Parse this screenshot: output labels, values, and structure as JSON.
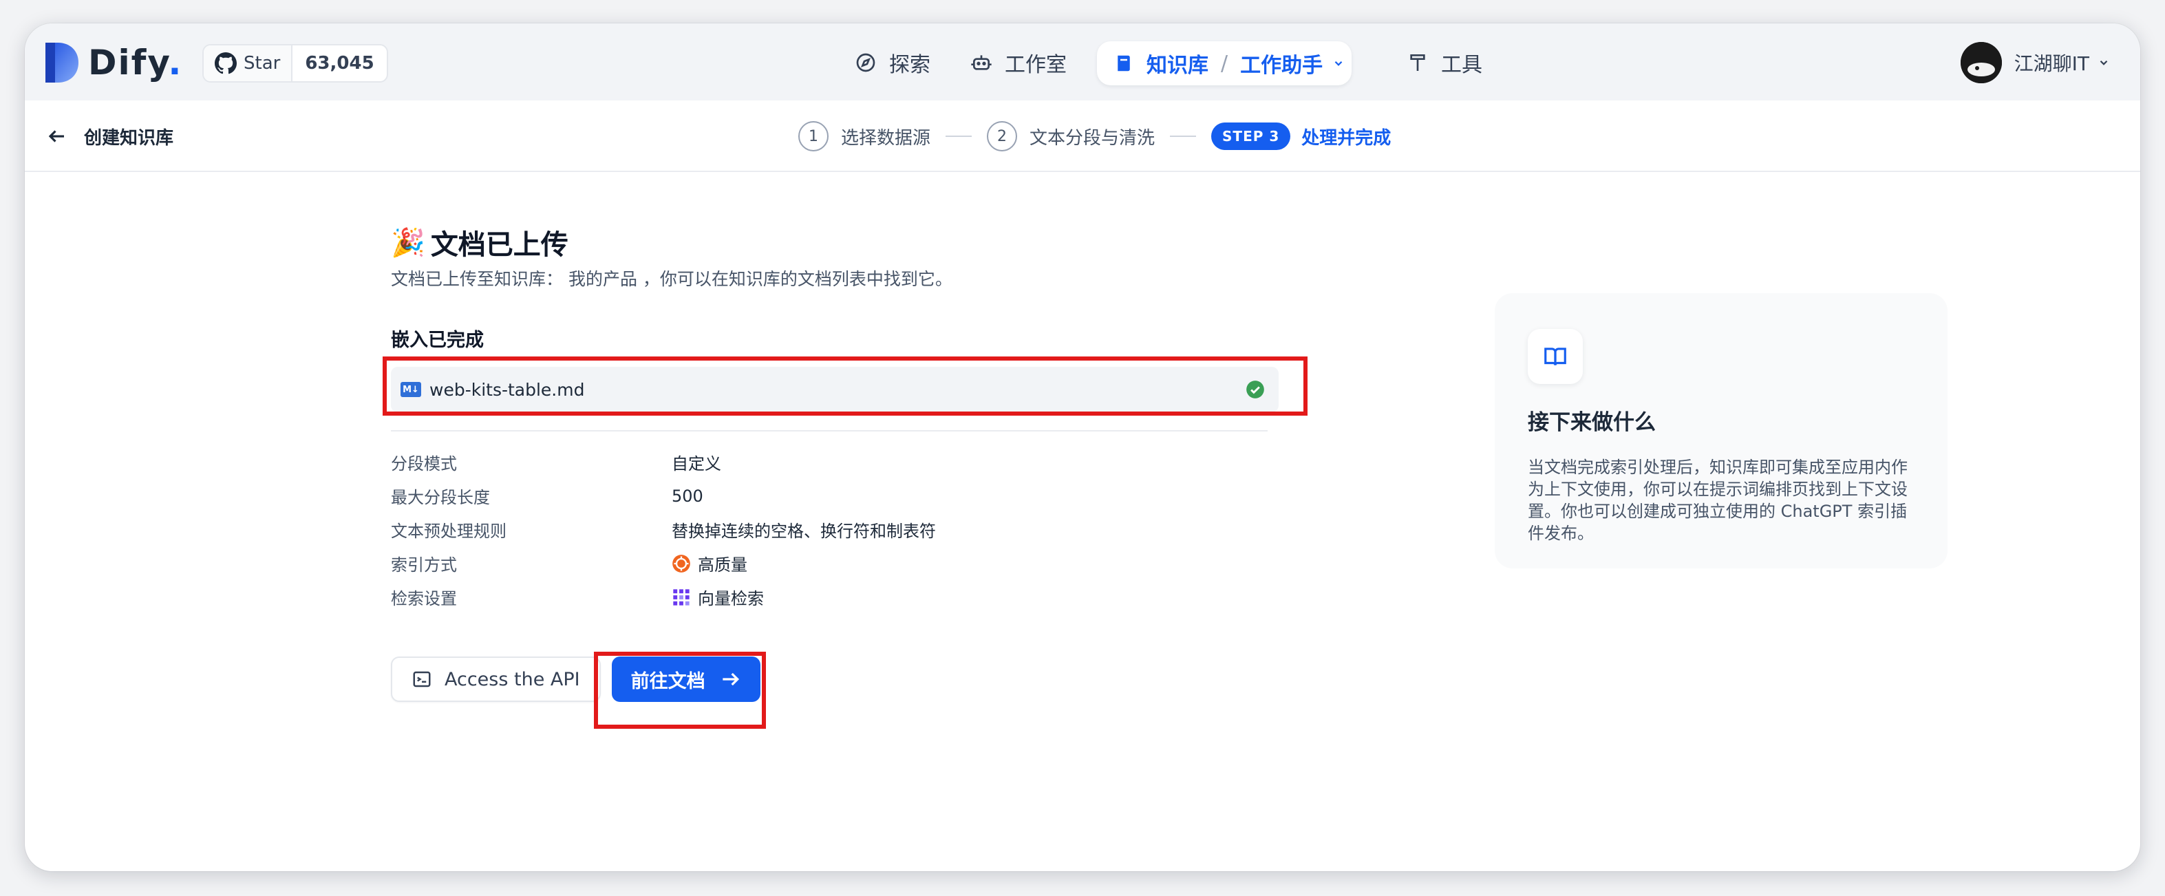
{
  "header": {
    "logo_text": "Dify",
    "logo_dot": ".",
    "github": {
      "star_label": "Star",
      "count": "63,045"
    },
    "nav": [
      {
        "label": "探索",
        "icon": "compass-icon"
      },
      {
        "label": "工作室",
        "icon": "robot-icon"
      },
      {
        "label": "工具",
        "icon": "hammer-icon"
      }
    ],
    "active_nav": {
      "label": "知识库",
      "dataset": "工作助手",
      "separator": "/"
    },
    "user": {
      "name": "江湖聊IT"
    }
  },
  "subheader": {
    "back_label": "创建知识库",
    "steps": [
      {
        "num": "1",
        "label": "选择数据源"
      },
      {
        "num": "2",
        "label": "文本分段与清洗"
      }
    ],
    "active_step": {
      "badge": "STEP 3",
      "label": "处理并完成"
    }
  },
  "main": {
    "title_emoji": "🎉",
    "title": "文档已上传",
    "subtitle": "文档已上传至知识库： 我的产品 ，你可以在知识库的文档列表中找到它。",
    "section_label": "嵌入已完成",
    "file": {
      "badge": "M↓",
      "name": "web-kits-table.md",
      "status": "completed"
    },
    "properties": [
      {
        "key": "分段模式",
        "value": "自定义"
      },
      {
        "key": "最大分段长度",
        "value": "500"
      },
      {
        "key": "文本预处理规则",
        "value": "替换掉连续的空格、换行符和制表符"
      },
      {
        "key": "索引方式",
        "value": "高质量",
        "icon": "high-quality-icon"
      },
      {
        "key": "检索设置",
        "value": "向量检索",
        "icon": "vector-search-icon"
      }
    ],
    "api_button": "Access the API",
    "primary_button": "前往文档"
  },
  "side_card": {
    "title": "接下来做什么",
    "description": "当文档完成索引处理后，知识库即可集成至应用内作为上下文使用，你可以在提示词编排页找到上下文设置。你也可以创建成可独立使用的 ChatGPT 索引插件发布。"
  },
  "colors": {
    "accent": "#155eef",
    "highlight": "#e21a1a",
    "success": "#3a9f55"
  }
}
